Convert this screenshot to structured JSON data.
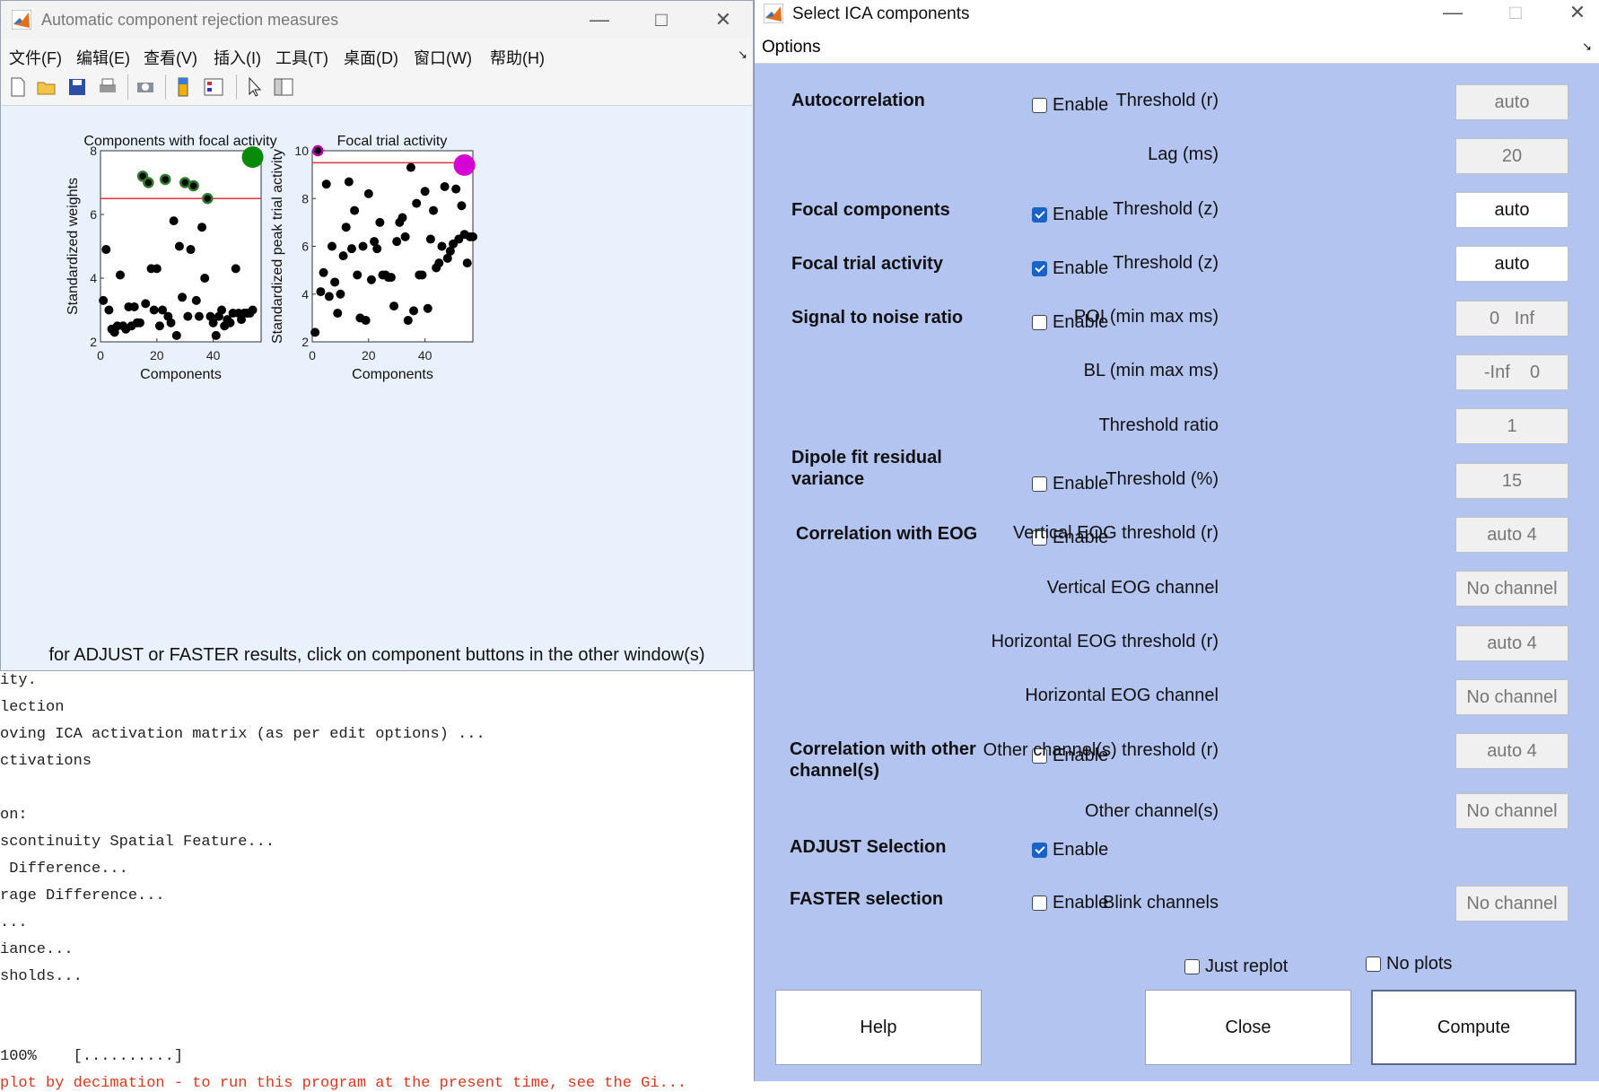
{
  "figure_window": {
    "title": "Automatic component rejection measures",
    "menu": [
      "文件(F)",
      "编辑(E)",
      "查看(V)",
      "插入(I)",
      "工具(T)",
      "桌面(D)",
      "窗口(W)",
      "帮助(H)"
    ],
    "toolbar_icons": [
      "new-file-icon",
      "open-folder-icon",
      "save-icon",
      "print-icon",
      "print-preview-icon",
      "colorbar-icon",
      "legend-icon",
      "pointer-icon",
      "property-inspector-icon"
    ],
    "note": "for ADJUST or FASTER results, click on component buttons in the other window(s)"
  },
  "console_lines": [
    "ity.",
    "lection",
    "oving ICA activation matrix (as per edit options) ...",
    "ctivations",
    "",
    "on:",
    "scontinuity Spatial Feature...",
    " Difference...",
    "rage Difference...",
    "...",
    "iance...",
    "sholds...",
    "",
    "",
    "100%    [..........]",
    "plot by decimation - to run this program at the present time, see the Gi..."
  ],
  "chart_data": [
    {
      "type": "scatter",
      "title": "Components with focal activity",
      "xlabel": "Components",
      "ylabel": "Standardized weights",
      "xlim": [
        0,
        57
      ],
      "ylim": [
        2,
        8
      ],
      "xticks": [
        0,
        20,
        40
      ],
      "yticks": [
        2,
        4,
        6,
        8
      ],
      "threshold": 6.5,
      "threshold_color": "#e8333a",
      "point_color": "#000000",
      "highlight_color": "#2d7a2d",
      "big_marker": {
        "x": 54,
        "y": 7.8,
        "color": "#0a8a0a"
      },
      "points": [
        [
          1,
          3.3
        ],
        [
          2,
          4.9
        ],
        [
          3,
          3.0
        ],
        [
          4,
          2.4
        ],
        [
          5,
          2.3
        ],
        [
          6,
          2.5
        ],
        [
          7,
          4.1
        ],
        [
          8,
          2.5
        ],
        [
          9,
          2.4
        ],
        [
          10,
          3.1
        ],
        [
          11,
          2.5
        ],
        [
          12,
          3.1
        ],
        [
          13,
          2.6
        ],
        [
          14,
          2.6
        ],
        [
          15,
          7.2
        ],
        [
          16,
          3.2
        ],
        [
          17,
          7.0
        ],
        [
          18,
          4.3
        ],
        [
          19,
          3.0
        ],
        [
          20,
          4.3
        ],
        [
          21,
          2.5
        ],
        [
          22,
          3.0
        ],
        [
          23,
          7.1
        ],
        [
          24,
          2.8
        ],
        [
          25,
          2.6
        ],
        [
          26,
          5.8
        ],
        [
          27,
          2.2
        ],
        [
          28,
          5.0
        ],
        [
          29,
          3.4
        ],
        [
          30,
          7.0
        ],
        [
          31,
          2.8
        ],
        [
          32,
          4.9
        ],
        [
          33,
          6.9
        ],
        [
          34,
          3.3
        ],
        [
          35,
          2.8
        ],
        [
          36,
          5.6
        ],
        [
          37,
          4.0
        ],
        [
          38,
          6.5
        ],
        [
          39,
          2.8
        ],
        [
          40,
          2.6
        ],
        [
          41,
          2.2
        ],
        [
          42,
          2.8
        ],
        [
          43,
          3.0
        ],
        [
          44,
          2.5
        ],
        [
          45,
          2.7
        ],
        [
          46,
          2.6
        ],
        [
          47,
          2.9
        ],
        [
          48,
          4.3
        ],
        [
          49,
          2.9
        ],
        [
          50,
          2.7
        ],
        [
          51,
          2.9
        ],
        [
          52,
          2.9
        ],
        [
          53,
          2.9
        ],
        [
          54,
          3.0
        ]
      ]
    },
    {
      "type": "scatter",
      "title": "Focal trial activity",
      "xlabel": "Components",
      "ylabel": "Standardized peak trial activity",
      "xlim": [
        0,
        57
      ],
      "ylim": [
        2,
        10
      ],
      "xticks": [
        0,
        20,
        40
      ],
      "yticks": [
        2,
        4,
        6,
        8,
        10
      ],
      "threshold": 9.5,
      "threshold_color": "#e8333a",
      "point_color": "#000000",
      "highlight_color": "#b000b0",
      "big_marker": {
        "x": 54,
        "y": 9.4,
        "color": "#d400d4"
      },
      "points": [
        [
          2,
          10.0
        ],
        [
          1,
          2.4
        ],
        [
          3,
          4.1
        ],
        [
          4,
          4.9
        ],
        [
          5,
          8.6
        ],
        [
          6,
          3.9
        ],
        [
          7,
          6.0
        ],
        [
          8,
          4.5
        ],
        [
          9,
          3.2
        ],
        [
          10,
          4.0
        ],
        [
          11,
          5.6
        ],
        [
          12,
          6.8
        ],
        [
          13,
          8.7
        ],
        [
          14,
          5.9
        ],
        [
          15,
          7.5
        ],
        [
          16,
          4.8
        ],
        [
          17,
          3.0
        ],
        [
          18,
          6.0
        ],
        [
          19,
          2.9
        ],
        [
          20,
          8.2
        ],
        [
          21,
          4.6
        ],
        [
          22,
          6.2
        ],
        [
          23,
          5.9
        ],
        [
          24,
          7.0
        ],
        [
          25,
          4.8
        ],
        [
          26,
          4.8
        ],
        [
          27,
          4.7
        ],
        [
          28,
          4.7
        ],
        [
          29,
          3.5
        ],
        [
          30,
          6.2
        ],
        [
          31,
          7.0
        ],
        [
          32,
          7.2
        ],
        [
          33,
          6.4
        ],
        [
          34,
          2.9
        ],
        [
          35,
          9.3
        ],
        [
          36,
          3.3
        ],
        [
          37,
          7.8
        ],
        [
          38,
          4.8
        ],
        [
          39,
          4.8
        ],
        [
          40,
          8.3
        ],
        [
          41,
          3.4
        ],
        [
          42,
          6.3
        ],
        [
          43,
          7.5
        ],
        [
          44,
          5.1
        ],
        [
          45,
          5.3
        ],
        [
          46,
          6.0
        ],
        [
          47,
          8.5
        ],
        [
          48,
          5.5
        ],
        [
          49,
          5.8
        ],
        [
          50,
          6.1
        ],
        [
          51,
          8.4
        ],
        [
          52,
          6.3
        ],
        [
          53,
          7.7
        ],
        [
          54,
          6.5
        ],
        [
          55,
          5.3
        ],
        [
          56,
          6.4
        ],
        [
          57,
          6.4
        ]
      ]
    }
  ],
  "dialog": {
    "title": "Select ICA components",
    "menu": "Options",
    "enable_label": "Enable",
    "rows": [
      {
        "label": "Autocorrelation",
        "checked": false
      },
      {
        "label": "Focal components",
        "checked": true
      },
      {
        "label": "Focal trial activity",
        "checked": true
      },
      {
        "label": "Signal to noise ratio",
        "checked": false
      },
      {
        "label": "Dipole fit residual variance",
        "checked": false
      },
      {
        "label": "Correlation with EOG",
        "checked": false
      },
      {
        "label": "Correlation with other channel(s)",
        "checked": false
      },
      {
        "label": "ADJUST Selection",
        "checked": true
      },
      {
        "label": "FASTER selection",
        "checked": false
      }
    ],
    "params": [
      {
        "label": "Threshold (r)",
        "value": "auto",
        "active": false
      },
      {
        "label": "Lag (ms)",
        "value": "20",
        "active": false
      },
      {
        "label": "Threshold (z)",
        "value": "auto",
        "active": true
      },
      {
        "label": "Threshold (z)",
        "value": "auto",
        "active": true
      },
      {
        "label": "POI (min max ms)",
        "value": "0   Inf",
        "active": false
      },
      {
        "label": "BL (min max ms)",
        "value": "-Inf    0",
        "active": false
      },
      {
        "label": "Threshold ratio",
        "value": "1",
        "active": false
      },
      {
        "label": "Threshold (%)",
        "value": "15",
        "active": false
      },
      {
        "label": "Vertical EOG threshold (r)",
        "value": "auto 4",
        "active": false
      },
      {
        "label": "Vertical EOG channel",
        "value": "No channel",
        "active": false
      },
      {
        "label": "Horizontal EOG threshold (r)",
        "value": "auto 4",
        "active": false
      },
      {
        "label": "Horizontal EOG channel",
        "value": "No channel",
        "active": false
      },
      {
        "label": "Other channel(s) threshold (r)",
        "value": "auto 4",
        "active": false
      },
      {
        "label": "Other channel(s)",
        "value": "No channel",
        "active": false
      },
      {
        "label": "Blink channels",
        "value": "No channel",
        "active": false
      }
    ],
    "just_replot": {
      "label": "Just replot",
      "checked": false
    },
    "no_plots": {
      "label": "No plots",
      "checked": false
    },
    "buttons": {
      "help": "Help",
      "close": "Close",
      "compute": "Compute"
    }
  }
}
